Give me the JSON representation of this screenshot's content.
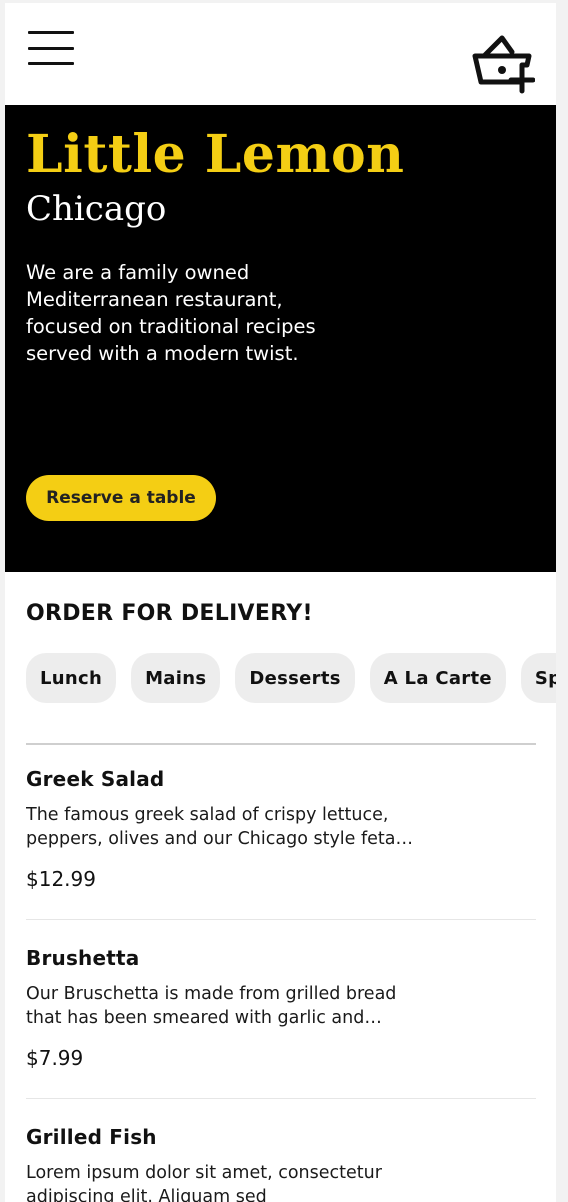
{
  "header": {
    "menu_icon": "hamburger-menu-icon",
    "basket_icon": "basket-add-icon"
  },
  "hero": {
    "title": "Little Lemon",
    "city": "Chicago",
    "description": "We are a family owned Mediterranean restaurant, focused on traditional recipes served with a modern twist.",
    "reserve_label": "Reserve a table"
  },
  "colors": {
    "brand_yellow": "#f4ce14",
    "hero_background": "#000000",
    "chip_background": "#ededed"
  },
  "order": {
    "title": "ORDER FOR DELIVERY!",
    "categories": [
      "Lunch",
      "Mains",
      "Desserts",
      "A La Carte",
      "Specials"
    ]
  },
  "menu": {
    "items": [
      {
        "name": "Greek Salad",
        "description": "The famous greek salad of crispy lettuce, peppers, olives and our Chicago style feta cheese",
        "price": "$12.99"
      },
      {
        "name": "Brushetta",
        "description": "Our Bruschetta is made from grilled bread that has been smeared with garlic and seasoned with salt and olive oil",
        "price": "$7.99"
      },
      {
        "name": "Grilled Fish",
        "description": "Lorem ipsum dolor sit amet, consectetur adipiscing elit. Aliquam sed",
        "price": ""
      }
    ]
  }
}
